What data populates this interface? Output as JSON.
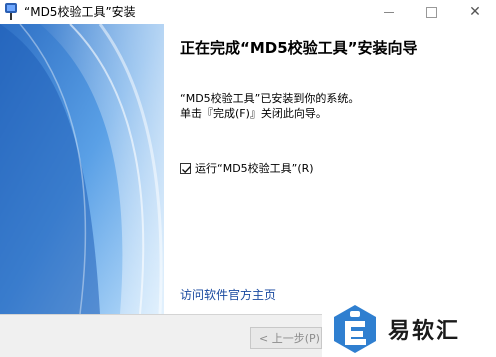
{
  "window": {
    "title": "“MD5校验工具”安装"
  },
  "page": {
    "heading": "正在完成“MD5校验工具”安装向导",
    "description_line1": "“MD5校验工具”已安装到你的系统。",
    "description_line2": "单击『完成(F)』关闭此向导。",
    "run_label": "运行“MD5校验工具”(R)",
    "run_checked": true,
    "link_text": "访问软件官方主页"
  },
  "footer": {
    "prev_button": "< 上一步(P)"
  },
  "watermark": {
    "text": "易软汇"
  },
  "colors": {
    "link": "#1a4aa0",
    "side_panel_blue": "#4a90d9",
    "watermark_blue": "#2f7fd0"
  }
}
